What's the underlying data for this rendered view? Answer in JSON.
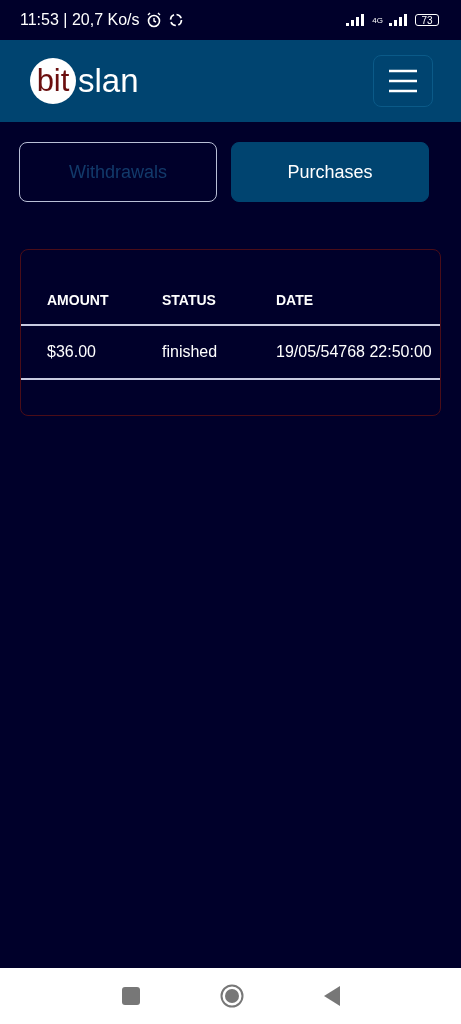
{
  "status_bar": {
    "time": "11:53 | 20,7 Ko/s",
    "network": "4G",
    "battery": "73"
  },
  "header": {
    "logo_badge": "bit",
    "logo_text": "slan"
  },
  "tabs": [
    {
      "label": "Withdrawals",
      "selected": false
    },
    {
      "label": "Purchases",
      "selected": true
    }
  ],
  "table": {
    "columns": [
      "AMOUNT",
      "STATUS",
      "DATE"
    ],
    "rows": [
      [
        "$36.00",
        "finished",
        "19/05/54768 22:50:00"
      ]
    ]
  }
}
